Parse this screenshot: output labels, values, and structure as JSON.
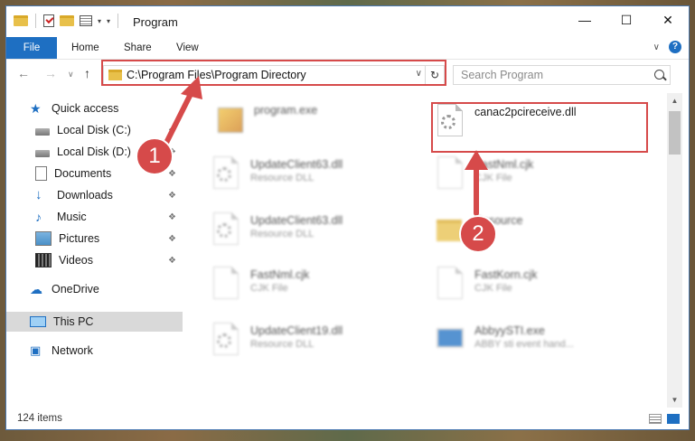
{
  "window": {
    "title": "Program"
  },
  "ribbon": {
    "tabs": [
      "File",
      "Home",
      "Share",
      "View"
    ]
  },
  "address": {
    "path": "C:\\Program Files\\Program Directory"
  },
  "search": {
    "placeholder": "Search Program"
  },
  "sidebar": {
    "items": [
      {
        "label": "Quick access",
        "icon": "star-icon",
        "pinned": false
      },
      {
        "label": "Local Disk (C:)",
        "icon": "disk-icon",
        "pinned": true
      },
      {
        "label": "Local Disk (D:)",
        "icon": "disk-icon",
        "pinned": true
      },
      {
        "label": "Documents",
        "icon": "documents-icon",
        "pinned": true
      },
      {
        "label": "Downloads",
        "icon": "downloads-icon",
        "pinned": true
      },
      {
        "label": "Music",
        "icon": "music-icon",
        "pinned": true
      },
      {
        "label": "Pictures",
        "icon": "pictures-icon",
        "pinned": true
      },
      {
        "label": "Videos",
        "icon": "videos-icon",
        "pinned": true
      },
      {
        "label": "OneDrive",
        "icon": "cloud-icon",
        "pinned": false
      },
      {
        "label": "This PC",
        "icon": "computer-icon",
        "pinned": false,
        "selected": true
      },
      {
        "label": "Network",
        "icon": "network-icon",
        "pinned": false
      }
    ]
  },
  "files": [
    {
      "name": "program.exe",
      "type": "",
      "icon": "exe-icon",
      "blurred": true
    },
    {
      "name": "canac2pcireceive.dll",
      "type": "",
      "icon": "dll-icon",
      "blurred": false
    },
    {
      "name": "UpdateClient63.dll",
      "type": "Resource DLL",
      "icon": "dll-icon",
      "blurred": true
    },
    {
      "name": "FastNml.cjk",
      "type": "CJK File",
      "icon": "file-icon",
      "blurred": true
    },
    {
      "name": "UpdateClient63.dll",
      "type": "Resource DLL",
      "icon": "dll-icon",
      "blurred": true
    },
    {
      "name": "Resource",
      "type": "",
      "icon": "folder-icon",
      "blurred": true
    },
    {
      "name": "FastNml.cjk",
      "type": "CJK File",
      "icon": "file-icon",
      "blurred": true
    },
    {
      "name": "FastKorn.cjk",
      "type": "CJK File",
      "icon": "file-icon",
      "blurred": true
    },
    {
      "name": "UpdateClient19.dll",
      "type": "Resource DLL",
      "icon": "dll-icon",
      "blurred": true
    },
    {
      "name": "AbbyySTI.exe",
      "type": "ABBY sti event hand...",
      "icon": "app-icon",
      "blurred": true
    }
  ],
  "status": {
    "items": "124 items"
  },
  "annotations": {
    "step1": "1",
    "step2": "2",
    "color": "#d64a4a"
  }
}
